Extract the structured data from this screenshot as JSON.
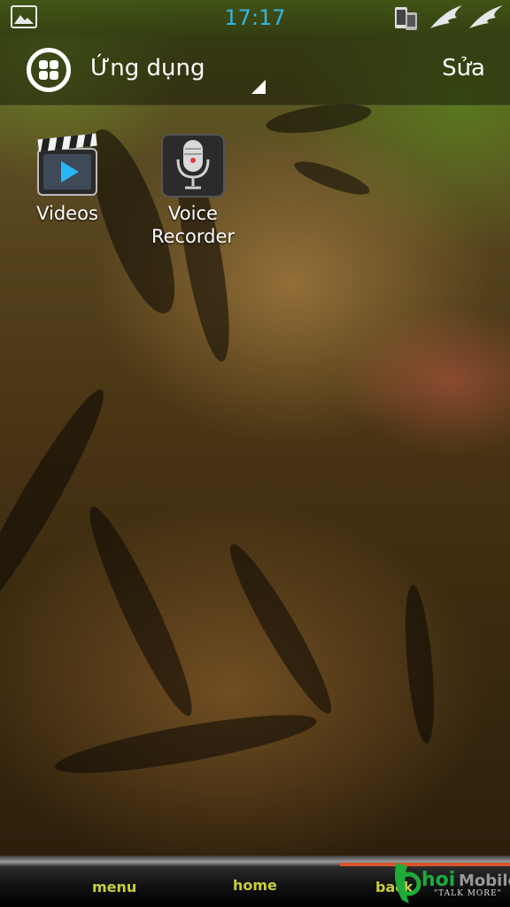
{
  "status_bar": {
    "time": "17:17",
    "icons": [
      "image-notification-icon",
      "phone-icon",
      "wings-logo-icon"
    ],
    "clock_color": "#33b5e5"
  },
  "header": {
    "title": "Ứng dụng",
    "edit_label": "Sửa"
  },
  "apps": [
    {
      "label": "Videos",
      "icon": "video-clapperboard-icon"
    },
    {
      "label": "Voice\nRecorder",
      "icon": "microphone-icon"
    }
  ],
  "nav_bar": {
    "menu_label": "menu",
    "home_label": "home",
    "back_label": "back",
    "label_color": "#c8cf3a",
    "accent_color": "#d8532c"
  },
  "watermark": {
    "tagline": "\"TALK MORE\""
  }
}
